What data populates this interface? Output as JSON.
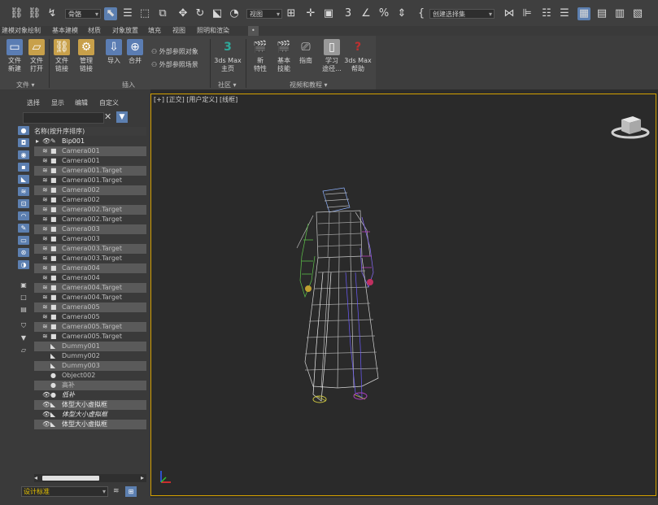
{
  "toolbar": {
    "layer_dropdown": "骨骼",
    "view_dropdown": "视图",
    "selection_set_dropdown": "创建选择集"
  },
  "menu_tabs": [
    "建模",
    "对象绘制",
    "基本建模",
    "材质",
    "对象放置",
    "填充",
    "视图",
    "照明和渲染",
    "•"
  ],
  "ribbon": {
    "buttons": [
      {
        "label1": "文件",
        "label2": "新建",
        "icon": "new-file-icon",
        "color": "#5b7db3"
      },
      {
        "label1": "文件",
        "label2": "打开",
        "icon": "open-file-icon",
        "color": "#c8a04a"
      },
      {
        "label1": "文件",
        "label2": "链接",
        "icon": "file-link-icon",
        "color": "#c8a04a"
      },
      {
        "label1": "管理",
        "label2": "链接",
        "icon": "manage-link-icon",
        "color": "#c8a04a"
      },
      {
        "label1": "导入",
        "label2": "",
        "icon": "import-icon",
        "color": "#5b7db3"
      },
      {
        "label1": "合并",
        "label2": "",
        "icon": "merge-icon",
        "color": "#5b7db3"
      },
      {
        "label1": "3ds Max",
        "label2": "主页",
        "icon": "max-home-icon",
        "color": "#2fa89a"
      },
      {
        "label1": "新",
        "label2": "特性",
        "icon": "new-features-icon",
        "color": "#777"
      },
      {
        "label1": "基本",
        "label2": "技能",
        "icon": "basic-skills-icon",
        "color": "#777"
      },
      {
        "label1": "指南",
        "label2": "",
        "icon": "guide-icon",
        "color": "#777"
      },
      {
        "label1": "学习",
        "label2": "途径...",
        "icon": "learning-path-icon",
        "color": "#999"
      },
      {
        "label1": "3ds Max",
        "label2": "帮助",
        "icon": "help-icon",
        "color": "#c03030"
      }
    ],
    "xref_object": "外部参照对象",
    "xref_scene": "外部参照场景",
    "section_file": "文件 ▾",
    "section_insert": "插入",
    "section_community": "社区 ▾",
    "section_video": "视频和教程 ▾"
  },
  "explorer": {
    "menu": [
      "选择",
      "显示",
      "编辑",
      "自定义"
    ],
    "column_header": "名称(按升序排序)",
    "rows": [
      {
        "name": "Bip001",
        "vis": "👁",
        "type": "✎",
        "style": "dark white"
      },
      {
        "name": "Camera001",
        "vis": "≋",
        "type": "■",
        "style": "grey"
      },
      {
        "name": "Camera001",
        "vis": "≋",
        "type": "■",
        "style": "dark"
      },
      {
        "name": "Camera001.Target",
        "vis": "≋",
        "type": "■",
        "style": "grey"
      },
      {
        "name": "Camera001.Target",
        "vis": "≋",
        "type": "■",
        "style": "dark"
      },
      {
        "name": "Camera002",
        "vis": "≋",
        "type": "■",
        "style": "grey"
      },
      {
        "name": "Camera002",
        "vis": "≋",
        "type": "■",
        "style": "dark"
      },
      {
        "name": "Camera002.Target",
        "vis": "≋",
        "type": "■",
        "style": "grey"
      },
      {
        "name": "Camera002.Target",
        "vis": "≋",
        "type": "■",
        "style": "dark"
      },
      {
        "name": "Camera003",
        "vis": "≋",
        "type": "■",
        "style": "grey"
      },
      {
        "name": "Camera003",
        "vis": "≋",
        "type": "■",
        "style": "dark"
      },
      {
        "name": "Camera003.Target",
        "vis": "≋",
        "type": "■",
        "style": "grey"
      },
      {
        "name": "Camera003.Target",
        "vis": "≋",
        "type": "■",
        "style": "dark"
      },
      {
        "name": "Camera004",
        "vis": "≋",
        "type": "■",
        "style": "grey"
      },
      {
        "name": "Camera004",
        "vis": "≋",
        "type": "■",
        "style": "dark"
      },
      {
        "name": "Camera004.Target",
        "vis": "≋",
        "type": "■",
        "style": "grey"
      },
      {
        "name": "Camera004.Target",
        "vis": "≋",
        "type": "■",
        "style": "dark"
      },
      {
        "name": "Camera005",
        "vis": "≋",
        "type": "■",
        "style": "grey"
      },
      {
        "name": "Camera005",
        "vis": "≋",
        "type": "■",
        "style": "dark"
      },
      {
        "name": "Camera005.Target",
        "vis": "≋",
        "type": "■",
        "style": "grey"
      },
      {
        "name": "Camera005.Target",
        "vis": "≋",
        "type": "■",
        "style": "dark"
      },
      {
        "name": "Dummy001",
        "vis": "",
        "type": "◣",
        "style": "grey"
      },
      {
        "name": "Dummy002",
        "vis": "",
        "type": "◣",
        "style": "dark"
      },
      {
        "name": "Dummy003",
        "vis": "",
        "type": "◣",
        "style": "grey"
      },
      {
        "name": "Object002",
        "vis": "",
        "type": "●",
        "style": "dark"
      },
      {
        "name": "高补",
        "vis": "",
        "type": "●",
        "style": "grey"
      },
      {
        "name": "低补",
        "vis": "👁",
        "type": "●",
        "style": "dark italic"
      },
      {
        "name": "体型大小虚拟框",
        "vis": "👁",
        "type": "◣",
        "style": "grey white"
      },
      {
        "name": "体型大小虚拟框",
        "vis": "👁",
        "type": "◣",
        "style": "dark italic"
      },
      {
        "name": "体型大小虚拟框",
        "vis": "👁",
        "type": "◣",
        "style": "grey white"
      }
    ],
    "scene_explorer_name": "设计标准"
  },
  "viewport": {
    "label": "[+] [正交] [用户定义] [线框]"
  }
}
